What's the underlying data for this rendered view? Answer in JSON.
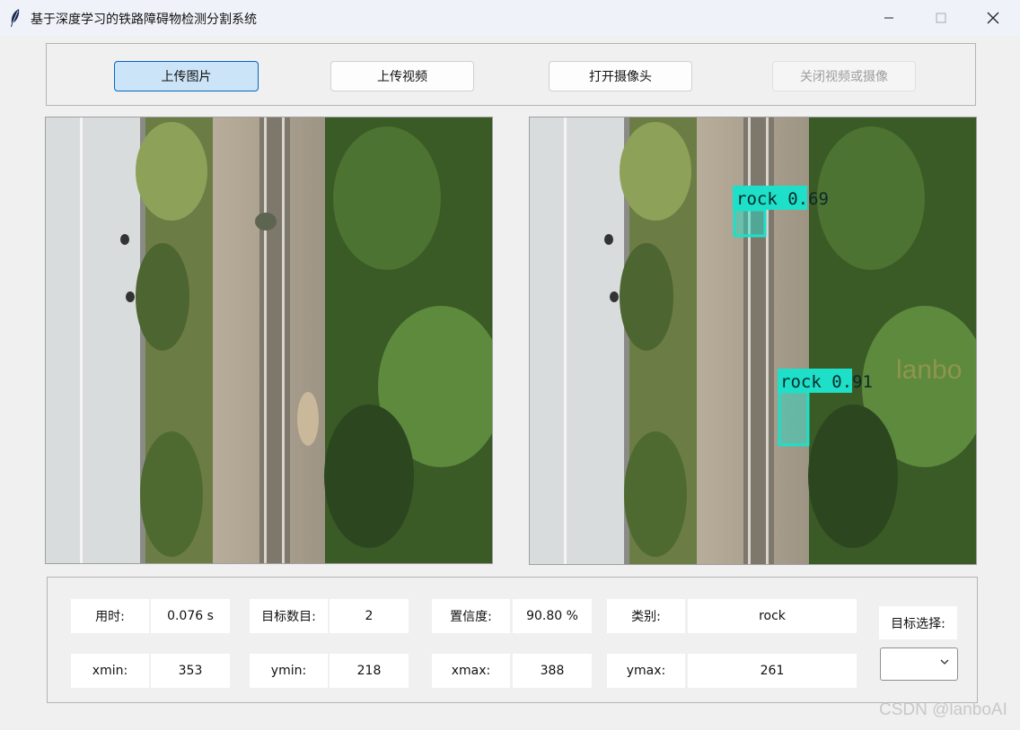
{
  "window": {
    "title": "基于深度学习的铁路障碍物检测分割系统",
    "icon": "feather-icon",
    "controls": [
      "minimize-icon",
      "maximize-icon",
      "close-icon"
    ]
  },
  "toolbar": {
    "upload_image": "上传图片",
    "upload_video": "上传视频",
    "open_camera": "打开摄像头",
    "close_video_camera": "关闭视频或摄像"
  },
  "panels": {
    "original": {
      "description_icon": "railway-aerial-image"
    },
    "result": {
      "detections": [
        {
          "label": "rock 0.69",
          "color": "#1ee0c8"
        },
        {
          "label": "rock 0.91",
          "color": "#1ee0c8"
        }
      ]
    }
  },
  "results": {
    "time_label": "用时:",
    "time_value": "0.076 s",
    "count_label": "目标数目:",
    "count_value": "2",
    "conf_label": "置信度:",
    "conf_value": "90.80 %",
    "class_label": "类别:",
    "class_value": "rock",
    "xmin_label": "xmin:",
    "xmin_value": "353",
    "ymin_label": "ymin:",
    "ymin_value": "218",
    "xmax_label": "xmax:",
    "xmax_value": "388",
    "ymax_label": "ymax:",
    "ymax_value": "261",
    "target_select_label": "目标选择:",
    "target_select_value": ""
  },
  "watermarks": {
    "corner": "CSDN @lanboAI",
    "overlay": "lanbo"
  },
  "colors": {
    "primary_button_bg": "#cce4f7",
    "primary_button_border": "#0067c0",
    "detection_box": "#1ee0c8"
  }
}
